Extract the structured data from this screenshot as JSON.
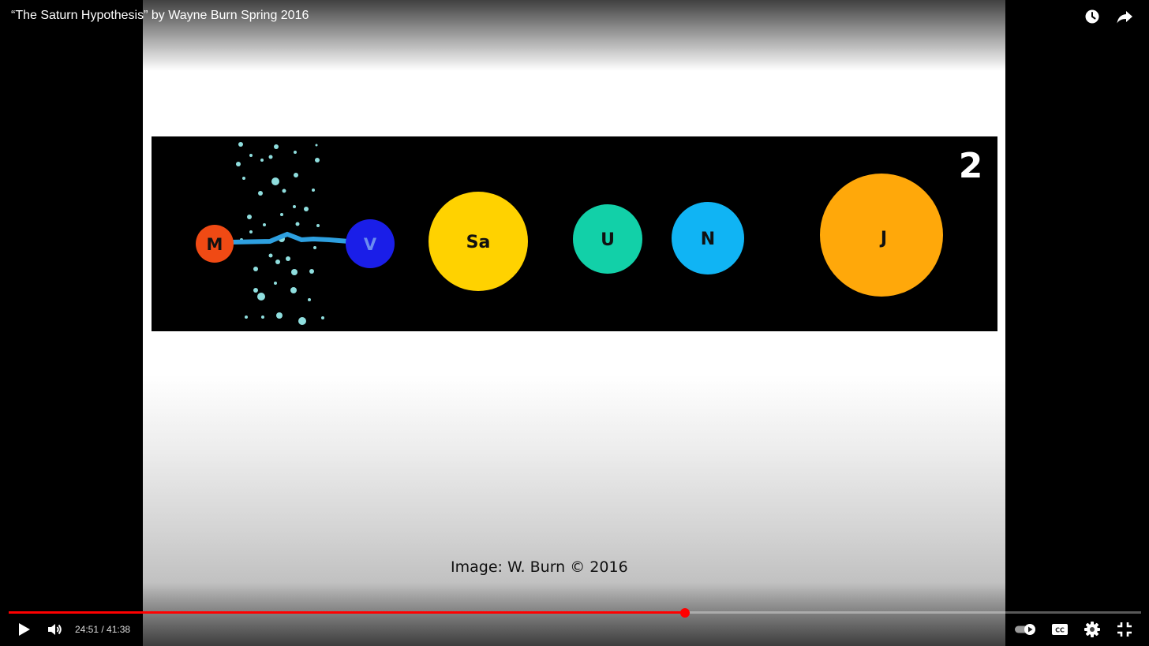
{
  "video": {
    "title": "“The Saturn Hypothesis” by Wayne Burn Spring 2016",
    "current_time": "24:51",
    "duration": "41:38",
    "time_separator": " / ",
    "progress_fraction": 0.597
  },
  "slide": {
    "number": "2",
    "caption": "Image: W. Burn © 2016",
    "bodies": [
      {
        "label": "M",
        "color": "#f04a14"
      },
      {
        "label": "V",
        "color": "#1a1ee8"
      },
      {
        "label": "Sa",
        "color": "#ffd200"
      },
      {
        "label": "U",
        "color": "#12d0a8"
      },
      {
        "label": "N",
        "color": "#10b4f4"
      },
      {
        "label": "J",
        "color": "#ffa80a"
      }
    ],
    "stream_color": "#2ea0e0",
    "dust_color": "#8fdede"
  },
  "colors": {
    "accent": "#ff0000",
    "control_icon": "#ffffff"
  },
  "icons": {
    "watch_later": "clock-icon",
    "share": "share-arrow-icon",
    "play": "play-icon",
    "volume": "volume-icon",
    "autoplay": "autoplay-toggle-icon",
    "captions": "cc-icon",
    "settings": "gear-icon",
    "exit_fullscreen": "exit-fullscreen-icon"
  }
}
